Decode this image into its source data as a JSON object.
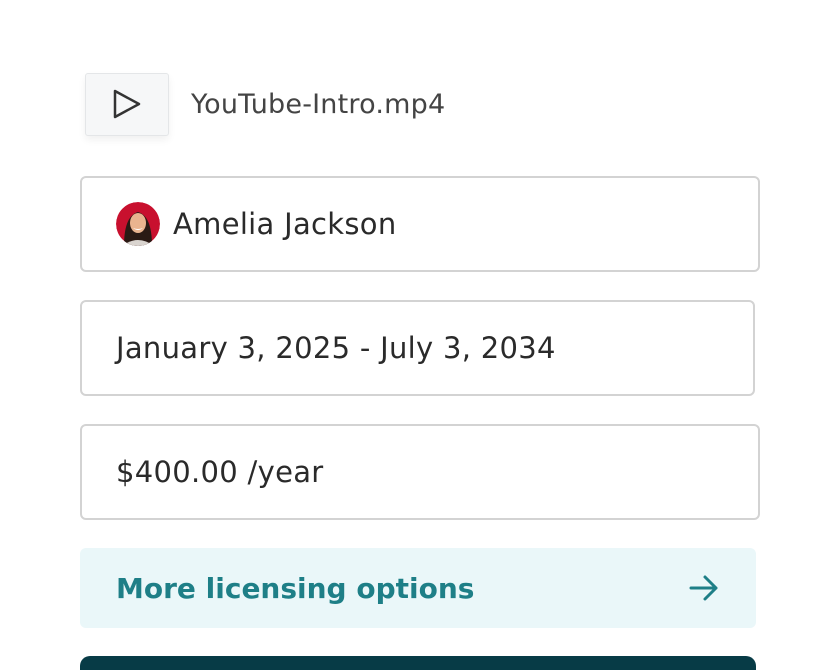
{
  "file": {
    "name": "YouTube-Intro.mp4",
    "icon": "play-icon"
  },
  "licensee": {
    "name": "Amelia Jackson",
    "avatar_icon": "avatar"
  },
  "license": {
    "date_range": "January 3, 2025 - July 3, 2034",
    "price": "$400.00 /year"
  },
  "more_options": {
    "label": "More licensing options",
    "icon": "arrow-right-icon"
  },
  "colors": {
    "accent": "#1e7f87",
    "accent_bg": "#eaf7f9",
    "primary_button": "#073b46",
    "border": "#d3d3d3"
  }
}
